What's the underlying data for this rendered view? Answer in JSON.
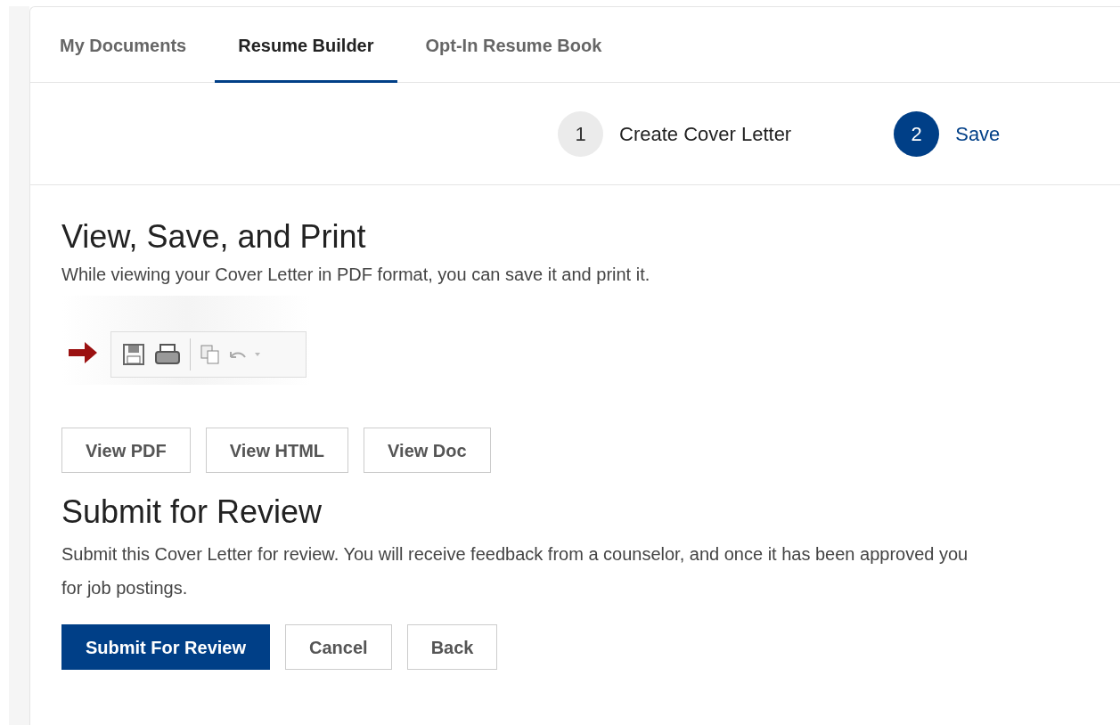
{
  "tabs": [
    {
      "label": "My Documents",
      "selected": false
    },
    {
      "label": "Resume Builder",
      "selected": true
    },
    {
      "label": "Opt-In Resume Book",
      "selected": false
    }
  ],
  "steps": [
    {
      "number": "1",
      "label": "Create Cover Letter",
      "selected": false
    },
    {
      "number": "2",
      "label": "Save",
      "selected": true
    }
  ],
  "view_section": {
    "title": "View, Save, and Print",
    "description": "While viewing your Cover Letter in PDF format, you can save it and print it.",
    "buttons": [
      "View PDF",
      "View HTML",
      "View Doc"
    ]
  },
  "review_section": {
    "title": "Submit for Review",
    "description_lines": [
      "Submit this Cover Letter for review. You will receive feedback from a counselor, and once it has been approved you",
      "for job postings."
    ],
    "buttons": [
      {
        "label": "Submit For Review",
        "kind": "primary"
      },
      {
        "label": "Cancel",
        "kind": "secondary"
      },
      {
        "label": "Back",
        "kind": "secondary"
      }
    ]
  }
}
